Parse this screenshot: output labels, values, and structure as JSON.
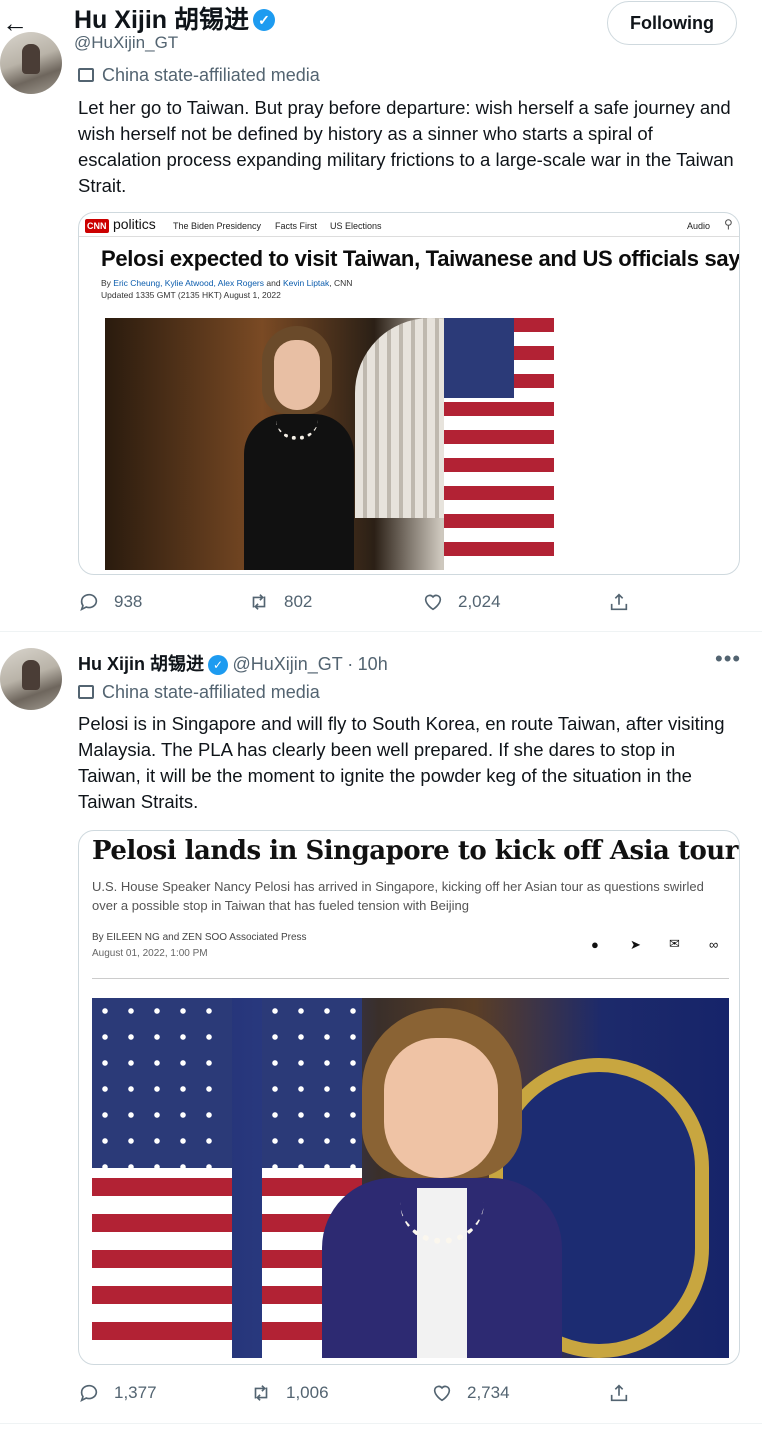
{
  "header": {
    "name": "Hu Xijin 胡锡进",
    "handle": "@HuXijin_GT",
    "follow_label": "Following"
  },
  "tweet1": {
    "label": "China state-affiliated media",
    "text": "Let her go to Taiwan. But pray before departure: wish herself a safe journey and wish herself not be defined by history as a sinner who starts a spiral of escalation process expanding military frictions to a large-scale war in the Taiwan Strait.",
    "card": {
      "logo": "CNN",
      "section": "politics",
      "nav": [
        "The Biden Presidency",
        "Facts First",
        "US Elections"
      ],
      "audio": "Audio",
      "headline": "Pelosi expected to visit Taiwan, Taiwanese and US officials say",
      "byline_prefix": "By",
      "authors": "Eric Cheung, Kylie Atwood, Alex Rogers",
      "and": "and",
      "author_last": "Kevin Liptak",
      "outlet": ", CNN",
      "updated": "Updated 1335 GMT (2135 HKT) August 1, 2022"
    },
    "replies": "938",
    "retweets": "802",
    "likes": "2,024"
  },
  "tweet2": {
    "name": "Hu Xijin 胡锡进",
    "handle": "@HuXijin_GT",
    "sep": "·",
    "time": "10h",
    "label": "China state-affiliated media",
    "text": "Pelosi is in Singapore and will fly to South Korea, en route Taiwan, after visiting Malaysia. The PLA has clearly been well prepared. If she dares to stop in Taiwan, it will be the moment to ignite the powder keg of the situation in the Taiwan Straits.",
    "card": {
      "headline": "Pelosi lands in Singapore to kick off Asia tour",
      "subheadline": "U.S. House Speaker Nancy Pelosi has arrived in Singapore, kicking off her Asian tour as questions swirled over a possible stop in Taiwan that has fueled tension with Beijing",
      "byline": "By EILEEN NG and ZEN SOO Associated Press",
      "date": "August 01, 2022, 1:00 PM"
    },
    "replies": "1,377",
    "retweets": "1,006",
    "likes": "2,734"
  }
}
